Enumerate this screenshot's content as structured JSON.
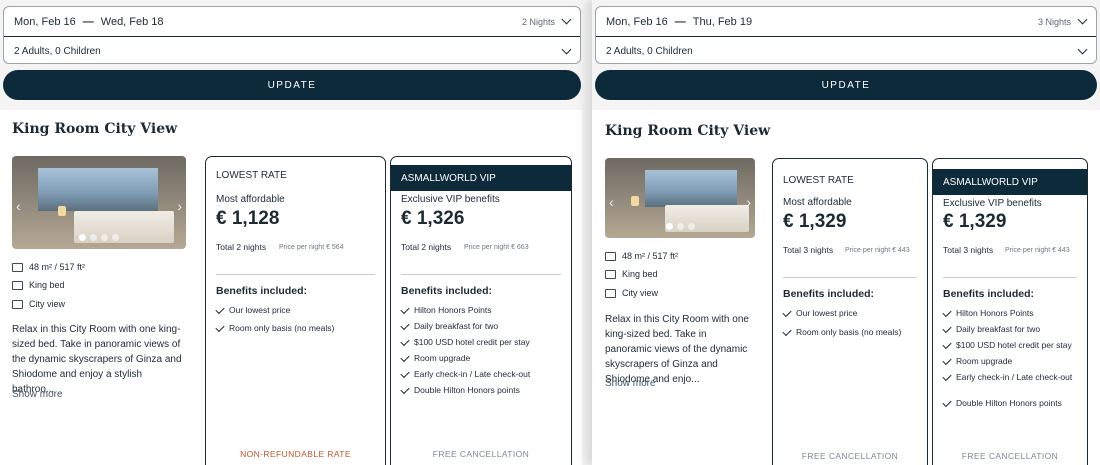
{
  "left": {
    "check_in": "Mon, Feb 16",
    "check_out": "Wed, Feb 18",
    "nights": "2 Nights",
    "guests": "2 Adults, 0 Children",
    "update_label": "UPDATE",
    "room_title": "King Room City View",
    "features": [
      "48 m² / 517 ft²",
      "King bed",
      "City view"
    ],
    "description": "Relax in this City Room with one king-sized bed. Take in panoramic views of the dynamic skyscrapers of Ginza and Shiodome and enjoy a stylish bathroo...",
    "show_more": "Show more",
    "lowest": {
      "header": "LOWEST RATE",
      "subtitle": "Most affordable",
      "price": "€ 1,128",
      "total": "Total 2 nights",
      "per_night": "Price per night € 564",
      "benefits_title": "Benefits included:",
      "benefits": [
        "Our lowest price",
        "Room only basis (no meals)"
      ],
      "footer": "NON-REFUNDABLE RATE"
    },
    "vip": {
      "header": "ASMALLWORLD VIP",
      "subtitle": "Exclusive VIP benefits",
      "price": "€ 1,326",
      "total": "Total 2 nights",
      "per_night": "Price per night € 663",
      "benefits_title": "Benefits included:",
      "benefits": [
        "Hilton Honors Points",
        "Daily breakfast for two",
        "$100 USD hotel credit per stay",
        "Room upgrade",
        "Early check-in / Late check-out",
        "Double Hilton Honors points"
      ],
      "footer": "FREE CANCELLATION"
    }
  },
  "right": {
    "check_in": "Mon, Feb 16",
    "check_out": "Thu, Feb 19",
    "nights": "3 Nights",
    "guests": "2 Adults, 0 Children",
    "update_label": "UPDATE",
    "room_title": "King Room City View",
    "features": [
      "48 m² / 517 ft²",
      "King bed",
      "City view"
    ],
    "description": "Relax in this City Room with one king-sized bed. Take in panoramic views of the dynamic skyscrapers of Ginza and Shiodome and enjo...",
    "show_more": "Show more",
    "lowest": {
      "header": "LOWEST RATE",
      "subtitle": "Most affordable",
      "price": "€ 1,329",
      "total": "Total 3 nights",
      "per_night": "Price per night € 443",
      "benefits_title": "Benefits included:",
      "benefits": [
        "Our lowest price",
        "Room only basis (no meals)"
      ],
      "footer": "FREE CANCELLATION"
    },
    "vip": {
      "header": "ASMALLWORLD VIP",
      "subtitle": "Exclusive VIP benefits",
      "price": "€ 1,329",
      "total": "Total 3 nights",
      "per_night": "Price per night € 443",
      "benefits_title": "Benefits included:",
      "benefits": [
        "Hilton Honors Points",
        "Daily breakfast for two",
        "$100 USD hotel credit per stay",
        "Room upgrade",
        "Early check-in / Late check-out",
        "Double Hilton Honors points"
      ],
      "footer": "FREE CANCELLATION"
    }
  }
}
